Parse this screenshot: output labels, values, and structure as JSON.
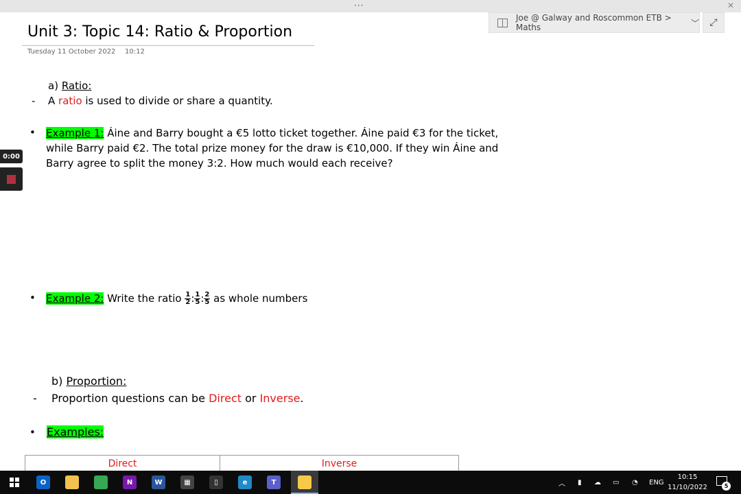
{
  "window": {
    "menu_dots": "···",
    "close": "✕"
  },
  "breadcrumb": {
    "text": "Joe @ Galway and Roscommon ETB > Maths",
    "chevron": "﹀",
    "expand_icon": "⤢"
  },
  "page": {
    "title": "Unit 3: Topic 14: Ratio & Proportion",
    "date": "Tuesday 11 October 2022",
    "time": "10:12"
  },
  "recorder": {
    "elapsed": "0:00"
  },
  "content": {
    "section_a_prefix": "a)",
    "section_a_label": "Ratio:",
    "ratio_dash": "-",
    "ratio_def_1": "A ",
    "ratio_def_word": "ratio",
    "ratio_def_2": " is used to divide or share a quantity.",
    "ex1_label": "Example 1:",
    "ex1_line1": " Áine and Barry bought a €5 lotto ticket together. Áine paid €3 for the ticket,",
    "ex1_line2": "while Barry paid €2. The total prize money for the draw is €10,000. If they win Áine and",
    "ex1_line3": "Barry agree to split the money 3:2. How much would each receive?",
    "ex2_label": "Example 2:",
    "ex2_text": " Write the ratio ",
    "ex2_fractions": [
      {
        "num": "1",
        "den": "2"
      },
      {
        "num": "1",
        "den": "5"
      },
      {
        "num": "2",
        "den": "5"
      }
    ],
    "ex2_sep": ":",
    "ex2_suffix": " as whole numbers",
    "section_b_prefix": "b)",
    "section_b_label": "Proportion:",
    "prop_dash": "-",
    "prop_text_1": "Proportion questions can be ",
    "prop_direct": "Direct",
    "prop_or": " or ",
    "prop_inverse": "Inverse",
    "prop_end": ".",
    "examples_label": "Examples:",
    "table_headers": [
      "Direct",
      "Inverse"
    ],
    "bullet": "•"
  },
  "taskbar": {
    "apps": [
      {
        "name": "outlook",
        "glyph": "O",
        "color": "#0a64c8"
      },
      {
        "name": "file-explorer",
        "glyph": "",
        "color": "#f2c14e"
      },
      {
        "name": "chrome",
        "glyph": "",
        "color": "#34a853"
      },
      {
        "name": "onenote",
        "glyph": "N",
        "color": "#7719aa"
      },
      {
        "name": "word",
        "glyph": "W",
        "color": "#2b579a"
      },
      {
        "name": "calculator",
        "glyph": "▦",
        "color": "#444444"
      },
      {
        "name": "phone",
        "glyph": "▯",
        "color": "#333333"
      },
      {
        "name": "edge",
        "glyph": "e",
        "color": "#1f8ac6"
      },
      {
        "name": "teams",
        "glyph": "T",
        "color": "#5b5fc7"
      },
      {
        "name": "sticky-notes",
        "glyph": "",
        "color": "#f7c948"
      }
    ],
    "tray_chevron": "︿",
    "language": "ENG",
    "clock_time": "10:15",
    "clock_date": "11/10/2022",
    "notification_count": "5"
  }
}
